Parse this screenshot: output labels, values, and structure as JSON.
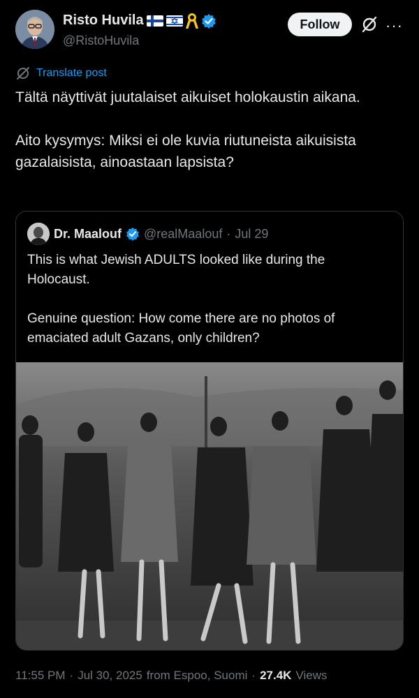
{
  "author": {
    "display_name": "Risto Huvila",
    "handle": "@RistoHuvila",
    "badges": [
      "finland-flag-icon",
      "israel-flag-icon",
      "yellow-ribbon-icon",
      "verified-icon"
    ]
  },
  "actions": {
    "follow_label": "Follow",
    "grok_icon": "grok-icon",
    "more_icon": "more-icon"
  },
  "translate": {
    "label": "Translate post",
    "icon": "globe-icon"
  },
  "post": {
    "paragraph_1": "Tältä näyttivät juutalaiset aikuiset holokaustin aikana.",
    "paragraph_2": "Aito kysymys: Miksi ei ole kuvia riutuneista aikuisista gazalaisista, ainoastaan lapsista?"
  },
  "quote": {
    "display_name": "Dr. Maalouf",
    "handle": "@realMaalouf",
    "separator": "·",
    "date": "Jul 29",
    "paragraph_1": "This is what Jewish ADULTS looked like during the Holocaust.",
    "paragraph_2": "Genuine question: How come there are no photos of emaciated adult Gazans, only children?",
    "photo": "black-and-white-photo"
  },
  "footer": {
    "time": "11:55 PM",
    "sep1": "·",
    "date": "Jul 30, 2025",
    "location": "from Espoo, Suomi",
    "sep2": "·",
    "views_count": "27.4K",
    "views_label": "Views"
  },
  "colors": {
    "background": "#000000",
    "text": "#e7e9ea",
    "muted": "#71767b",
    "accent": "#1d9bf0",
    "border": "#2f3336"
  }
}
